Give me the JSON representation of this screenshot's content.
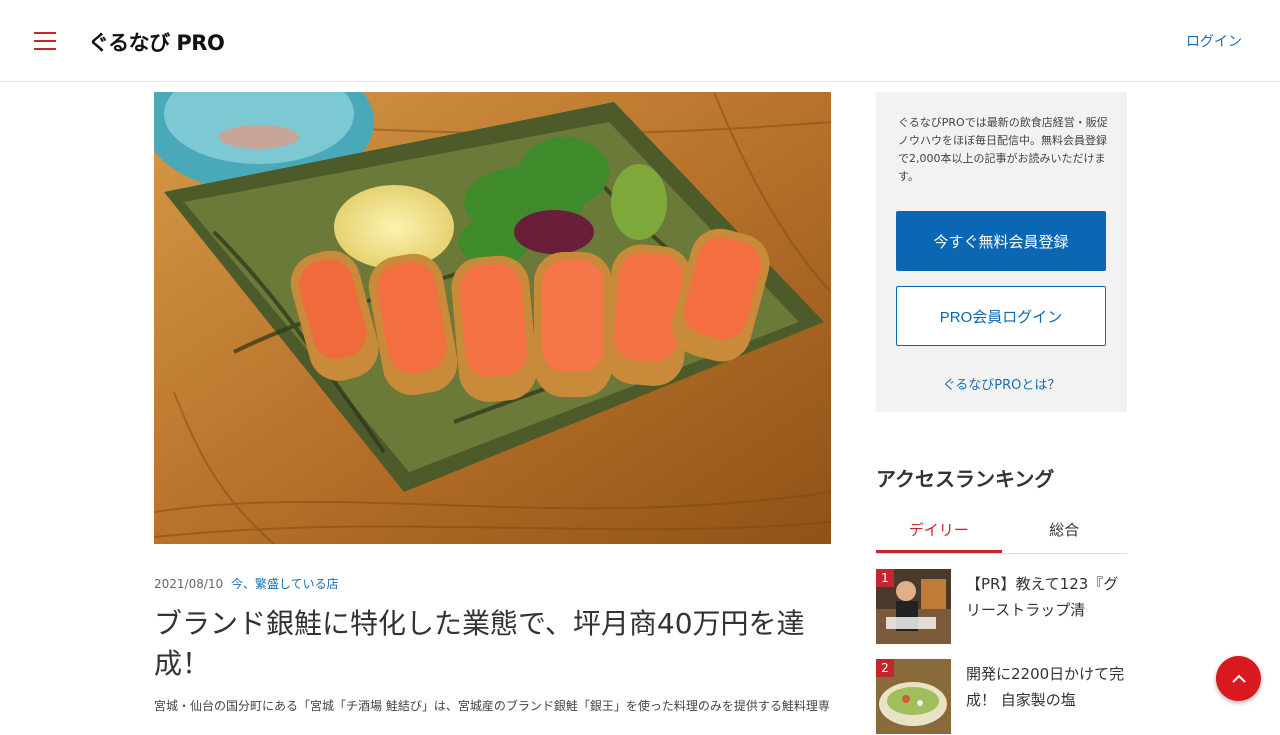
{
  "header": {
    "logo": "ぐるなび PRO",
    "login_label": "ログイン"
  },
  "article": {
    "date": "2021/08/10",
    "category": "今、繁盛している店",
    "title": "ブランド銀鮭に特化した業態で、坪月商40万円を達成！",
    "lead": "宮城・仙台の国分町にある「宮城「チ酒場 鮭結び」は、宮城産のブランド銀鮭「銀王」を使った料理のみを提供する鮭料理専門"
  },
  "sidebar": {
    "description": "ぐるなびPROでは最新の飲食店経営・販促ノウハウをほぼ毎日配信中。無料会員登録で2,000本以上の記事がお読みいただけます。",
    "register_button": "今すぐ無料会員登録",
    "login_button": "PRO会員ログイン",
    "about_link": "ぐるなびPROとは？"
  },
  "ranking": {
    "title": "アクセスランキング",
    "tabs": [
      {
        "label": "デイリー"
      },
      {
        "label": "総合"
      }
    ],
    "items": [
      {
        "rank": "1",
        "title": "【PR】教えて123『グリーストラップ清"
      },
      {
        "rank": "2",
        "title": "開発に2200日かけて完成！ 自家製の塩"
      }
    ]
  },
  "icons": {
    "menu": "hamburger-menu-icon",
    "scroll_top": "chevron-up-icon"
  },
  "colors": {
    "brand_red": "#c1272d",
    "link_blue": "#1a6fb5",
    "button_blue": "#0b67b3"
  }
}
